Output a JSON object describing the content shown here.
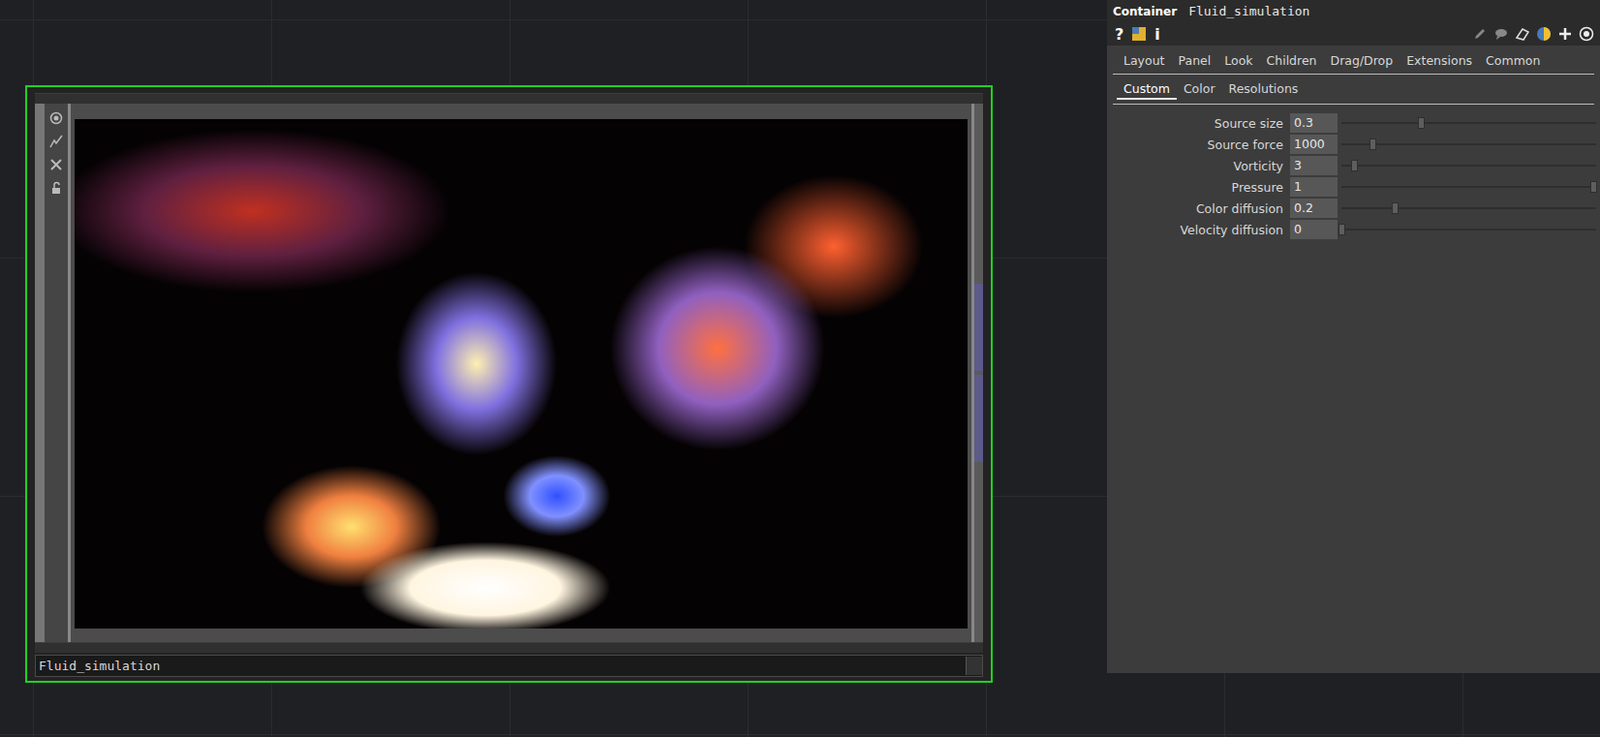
{
  "node": {
    "label": "Fluid_simulation"
  },
  "panel": {
    "type": "Container",
    "name": "Fluid_simulation",
    "help_glyph": "?",
    "info_glyph": "i"
  },
  "tabs": [
    {
      "label": "Layout",
      "selected": false
    },
    {
      "label": "Panel",
      "selected": false
    },
    {
      "label": "Look",
      "selected": false
    },
    {
      "label": "Children",
      "selected": false
    },
    {
      "label": "Drag/Drop",
      "selected": false
    },
    {
      "label": "Extensions",
      "selected": false
    },
    {
      "label": "Common",
      "selected": false
    }
  ],
  "subtabs": [
    {
      "label": "Custom",
      "selected": true
    },
    {
      "label": "Color",
      "selected": false
    },
    {
      "label": "Resolutions",
      "selected": false
    }
  ],
  "params": [
    {
      "name": "Source size",
      "value": "0.3",
      "level": 0.31
    },
    {
      "name": "Source force",
      "value": "1000",
      "level": 0.12
    },
    {
      "name": "Vorticity",
      "value": "3",
      "level": 0.05
    },
    {
      "name": "Pressure",
      "value": "1",
      "level": 0.99
    },
    {
      "name": "Color diffusion",
      "value": "0.2",
      "level": 0.21
    },
    {
      "name": "Velocity diffusion",
      "value": "0",
      "level": 0.0
    }
  ]
}
